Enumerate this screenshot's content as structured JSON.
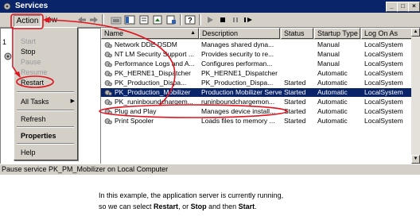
{
  "window": {
    "title": "Services",
    "controls": [
      "minimize-icon",
      "maximize-icon",
      "close-icon"
    ]
  },
  "menubar": {
    "action": "Action",
    "view_rest": "iew"
  },
  "left_pane": {
    "item_number": "1"
  },
  "action_menu": {
    "items": [
      {
        "label": "Start",
        "enabled": false
      },
      {
        "label": "Stop",
        "enabled": true
      },
      {
        "label": "Pause",
        "enabled": false
      },
      {
        "label": "Resume",
        "enabled": false
      },
      {
        "label": "Restart",
        "enabled": true
      },
      {
        "label": "All Tasks",
        "enabled": true,
        "submenu": true
      },
      {
        "label": "Refresh",
        "enabled": true
      },
      {
        "label": "Properties",
        "enabled": true,
        "bold": true
      },
      {
        "label": "Help",
        "enabled": true
      }
    ]
  },
  "columns": [
    "Name",
    "Description",
    "Status",
    "Startup Type",
    "Log On As"
  ],
  "sort_indicator": "▲",
  "services": [
    {
      "name": "Network DDE DSDM",
      "description": "Manages shared dyna...",
      "status": "",
      "startup": "Manual",
      "logon": "LocalSystem"
    },
    {
      "name": "NT LM Security Support ...",
      "description": "Provides security to re...",
      "status": "",
      "startup": "Manual",
      "logon": "LocalSystem"
    },
    {
      "name": "Performance Logs and A...",
      "description": "Configures performan...",
      "status": "",
      "startup": "Manual",
      "logon": "LocalSystem"
    },
    {
      "name": "PK_HERNE1_Dispatcher",
      "description": "PK_HERNE1_Dispatcher",
      "status": "",
      "startup": "Automatic",
      "logon": "LocalSystem"
    },
    {
      "name": "PK_Production_Dispa...",
      "description": "PK_Production_Dispa...",
      "status": "Started",
      "startup": "Automatic",
      "logon": "LocalSystem"
    },
    {
      "name": "PK_Production_Mobilizer",
      "description": "Production Mobilizer Server",
      "status": "Started",
      "startup": "Automatic",
      "logon": "LocalSystem",
      "selected": true
    },
    {
      "name": "PK_runinboundchargem...",
      "description": "runinboundchargemon...",
      "status": "Started",
      "startup": "Automatic",
      "logon": "LocalSystem"
    },
    {
      "name": "Plug and Play",
      "description": "Manages device install...",
      "status": "Started",
      "startup": "Automatic",
      "logon": "LocalSystem"
    },
    {
      "name": "Print Spooler",
      "description": "Loads files to memory ...",
      "status": "Started",
      "startup": "Automatic",
      "logon": "LocalSystem"
    }
  ],
  "status_bar": "Pause service PK_PM_Mobilizer on Local Computer",
  "caption": {
    "line1": "In this example, the application server is currently running,",
    "line2_prefix": "so we can select ",
    "line2_restart": "Restart",
    "line2_mid1": ", or ",
    "line2_stop": "Stop",
    "line2_mid2": " and then ",
    "line2_start": "Start",
    "line2_end": "."
  },
  "annotation_color": "#e0141e",
  "colors": {
    "title_bar": "#0a246a",
    "selection": "#0a246a",
    "face": "#d4d0c8"
  }
}
